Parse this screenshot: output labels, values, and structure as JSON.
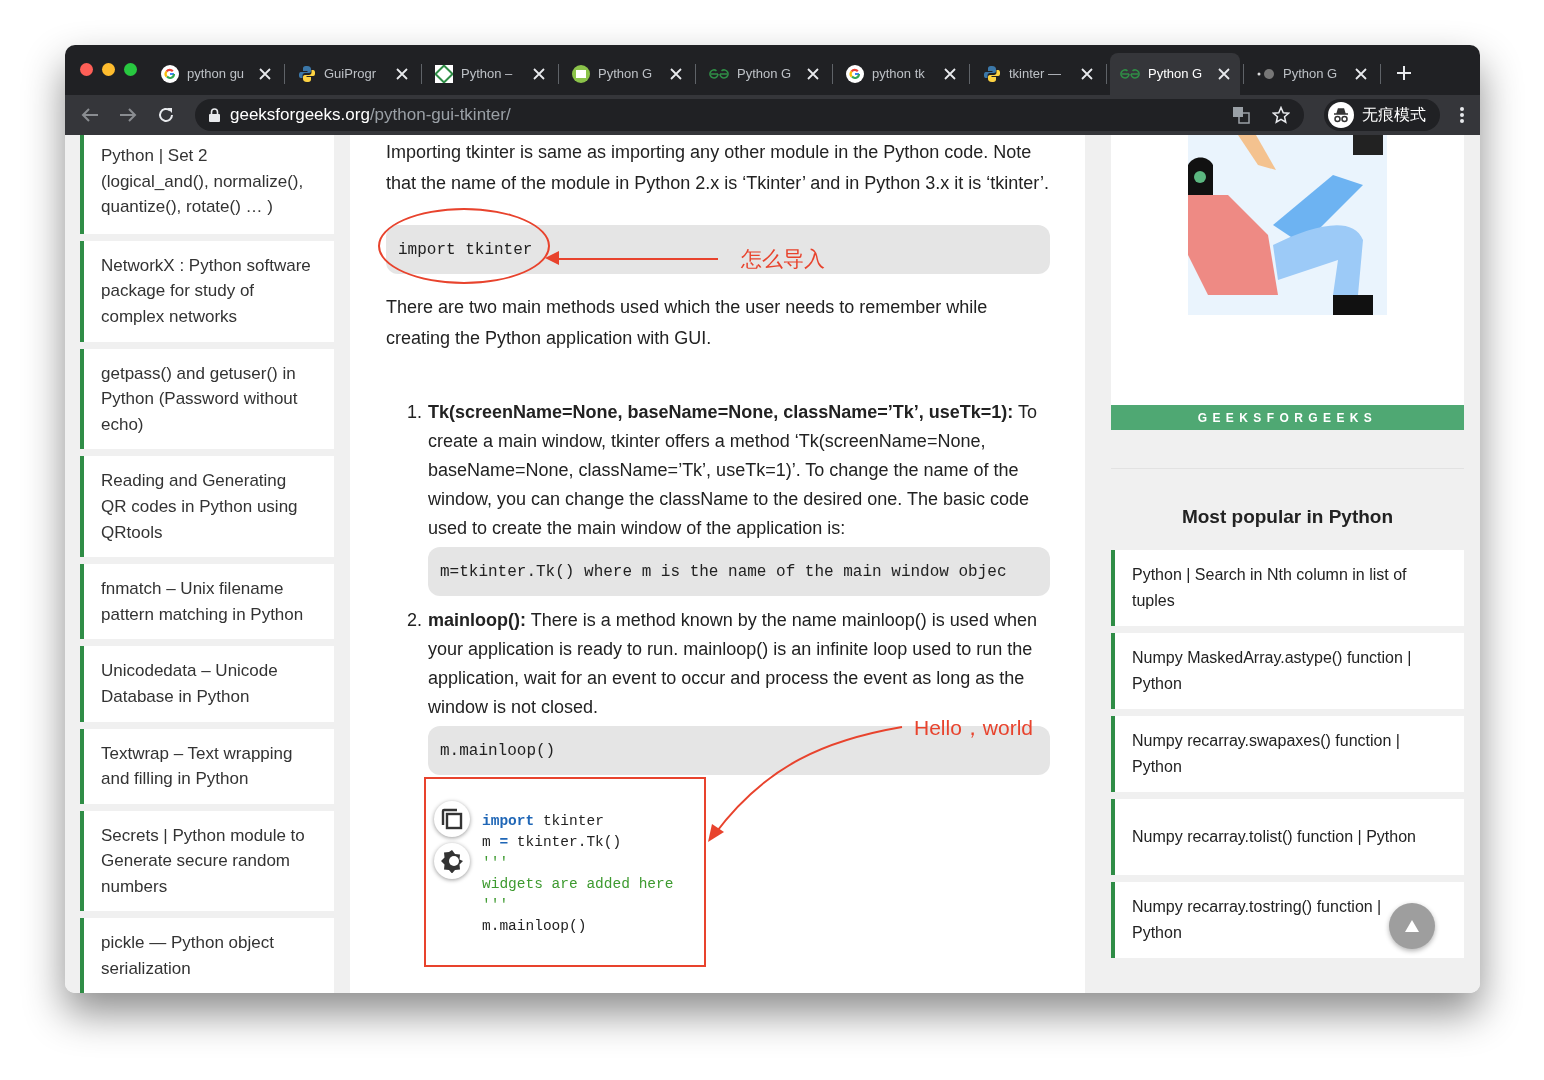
{
  "browser": {
    "tabs": [
      {
        "title": "python gu",
        "kind": "google",
        "selected": false
      },
      {
        "title": "GuiProgr",
        "kind": "python",
        "selected": false
      },
      {
        "title": "Python –",
        "kind": "square",
        "selected": false
      },
      {
        "title": "Python G",
        "kind": "round",
        "selected": false
      },
      {
        "title": "Python G",
        "kind": "gfg",
        "selected": false
      },
      {
        "title": "python tk",
        "kind": "google",
        "selected": false
      },
      {
        "title": "tkinter —",
        "kind": "python",
        "selected": false
      },
      {
        "title": "Python G",
        "kind": "gfg",
        "selected": true
      },
      {
        "title": "Python G",
        "kind": "dots",
        "selected": false
      }
    ],
    "url_host": "geeksforgeeks.org",
    "url_path": "/python-gui-tkinter/",
    "profile_label": "无痕模式"
  },
  "sidebar": {
    "items": [
      "Python | Set 2 (logical_and(), normalize(), quantize(), rotate() … )",
      "NetworkX : Python software package for study of complex networks",
      "getpass() and getuser() in Python (Password without echo)",
      "Reading and Generating QR codes in Python using QRtools",
      "fnmatch – Unix filename pattern matching in Python",
      "Unicodedata – Unicode Database in Python",
      "Textwrap – Text wrapping and filling in Python",
      "Secrets | Python module to Generate secure random numbers",
      "pickle — Python object serialization"
    ]
  },
  "article": {
    "intro": "Importing tkinter is same as importing any other module in the Python code. Note that the name of the module in Python 2.x is ‘Tkinter’ and in Python 3.x it is ‘tkinter’.",
    "import_code": "import tkinter",
    "paragraph": "There are two main methods used which the user needs to remember while creating the Python application with GUI.",
    "methods": [
      {
        "number": "1.",
        "text": "**Tk(screenName=None, baseName=None, className=’Tk’, useTk=1):** To create a main window, tkinter offers a method ‘Tk(screenName=None, baseName=None, className=’Tk’, useTk=1)’. To change the name of the window, you can change the className to the desired one. The basic code used to create the main window of the application is:",
        "code": "m=tkinter.Tk() where m is the name of the main window objec"
      },
      {
        "number": "2.",
        "text": "**mainloop():** There is a method known by the name mainloop() is used when your application is ready to run. mainloop() is an infinite loop used to run the application, wait for an event to occur and process the event as long as the window is not closed.",
        "code": "m.mainloop()"
      }
    ],
    "example_code": [
      [
        {
          "kind": "keyword",
          "text": "import"
        },
        {
          "kind": "plain",
          "text": " tkinter"
        }
      ],
      [
        {
          "kind": "plain",
          "text": "m "
        },
        {
          "kind": "keyword",
          "text": "="
        },
        {
          "kind": "plain",
          "text": " tkinter.Tk()"
        }
      ],
      [
        {
          "kind": "comment",
          "text": "'''"
        }
      ],
      [
        {
          "kind": "comment",
          "text": "widgets are added here"
        }
      ],
      [
        {
          "kind": "comment",
          "text": "'''"
        }
      ],
      [
        {
          "kind": "plain",
          "text": "m.mainloop()"
        }
      ]
    ],
    "annotations": [
      {
        "kind": "ellipse",
        "text": "怎么导入"
      },
      {
        "kind": "curve",
        "text": "Hello，world"
      }
    ]
  },
  "right": {
    "banner": "GEEKSFORGEEKS",
    "heading": "Most popular in Python",
    "items": [
      "Python | Search in Nth column in list of tuples",
      "Numpy MaskedArray.astype() function | Python",
      "Numpy recarray.swapaxes() function | Python",
      "Numpy recarray.tolist() function | Python",
      "Numpy recarray.tostring() function | Python"
    ]
  }
}
